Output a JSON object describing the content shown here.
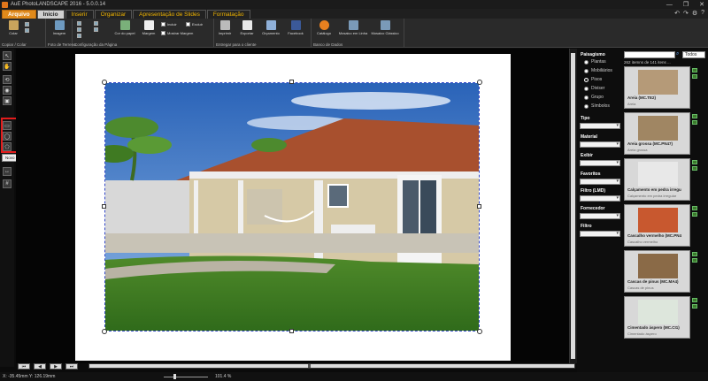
{
  "window": {
    "title": "AuE PhotoLANDSCAPE 2016 - 5.0.0.14"
  },
  "tabs": [
    {
      "label": "Arquivo",
      "style": "orange"
    },
    {
      "label": "Inicio",
      "style": "active"
    },
    {
      "label": "Inserir",
      "style": ""
    },
    {
      "label": "Organizar",
      "style": ""
    },
    {
      "label": "Apresentação de Slides",
      "style": ""
    },
    {
      "label": "Formatação",
      "style": ""
    }
  ],
  "ribbon": {
    "groups": [
      "Copiar / Colar",
      "Foto de Terreno",
      "Configuração da Página",
      "Entregar para o cliente",
      "Banco de Dados"
    ],
    "buttons": {
      "colar": "Colar",
      "imagem": "Imagem",
      "cor_papel": "Cor do papel",
      "margem": "Margem",
      "incluir": "Incluir",
      "excluir": "Excluir",
      "mostrar_margem": "Mostrar Margem",
      "imprimir": "Imprimir",
      "exportar": "Exportar",
      "orcamento": "Orçamento",
      "facebook": "Facebook",
      "catalogo": "Catálogo",
      "mosaico_linha": "Mosaico em Linha",
      "mosaico_classico": "Mosaico Clássico"
    }
  },
  "tooltip": "Novo Polígono",
  "status": {
    "coords": "X: -35.45mm Y: 126.19mm",
    "zoom": "101.4 %"
  },
  "panel": {
    "title": "Paisagismo",
    "radios": [
      {
        "label": "Plantas",
        "on": false
      },
      {
        "label": "Mobiliários",
        "on": false
      },
      {
        "label": "Pisos",
        "on": true
      },
      {
        "label": "Diviser",
        "on": false
      },
      {
        "label": "Grupo",
        "on": false
      },
      {
        "label": "Símbolos",
        "on": false
      }
    ],
    "filters": [
      "Tipo",
      "Material",
      "Exibir",
      "Favoritos",
      "Filtro (LMD)",
      "Fornecedor",
      "Filtro"
    ],
    "search_filter": "Todos",
    "count": "262 itemns de 141 itens ...",
    "items": [
      {
        "name": "Areia (MC.TE2)",
        "sub": "Areia",
        "color": "#b59a78"
      },
      {
        "name": "Areia grossa (MC.PN47)",
        "sub": "Areia grossa",
        "color": "#a08663"
      },
      {
        "name": "Calçamento em pedra irregu",
        "sub": "Calçamento em pedra irregular",
        "color": "#e8e8e8"
      },
      {
        "name": "Cascalho vermelho (MC.PN4",
        "sub": "Cascalho vermelho",
        "color": "#c8582f"
      },
      {
        "name": "Cascas de pinus (MC.MA4)",
        "sub": "Cascas de pinus",
        "color": "#8a6a47"
      },
      {
        "name": "Cimentado áspero (MC.CI1)",
        "sub": "Cimentado áspero",
        "color": "#dde6dc"
      }
    ]
  }
}
